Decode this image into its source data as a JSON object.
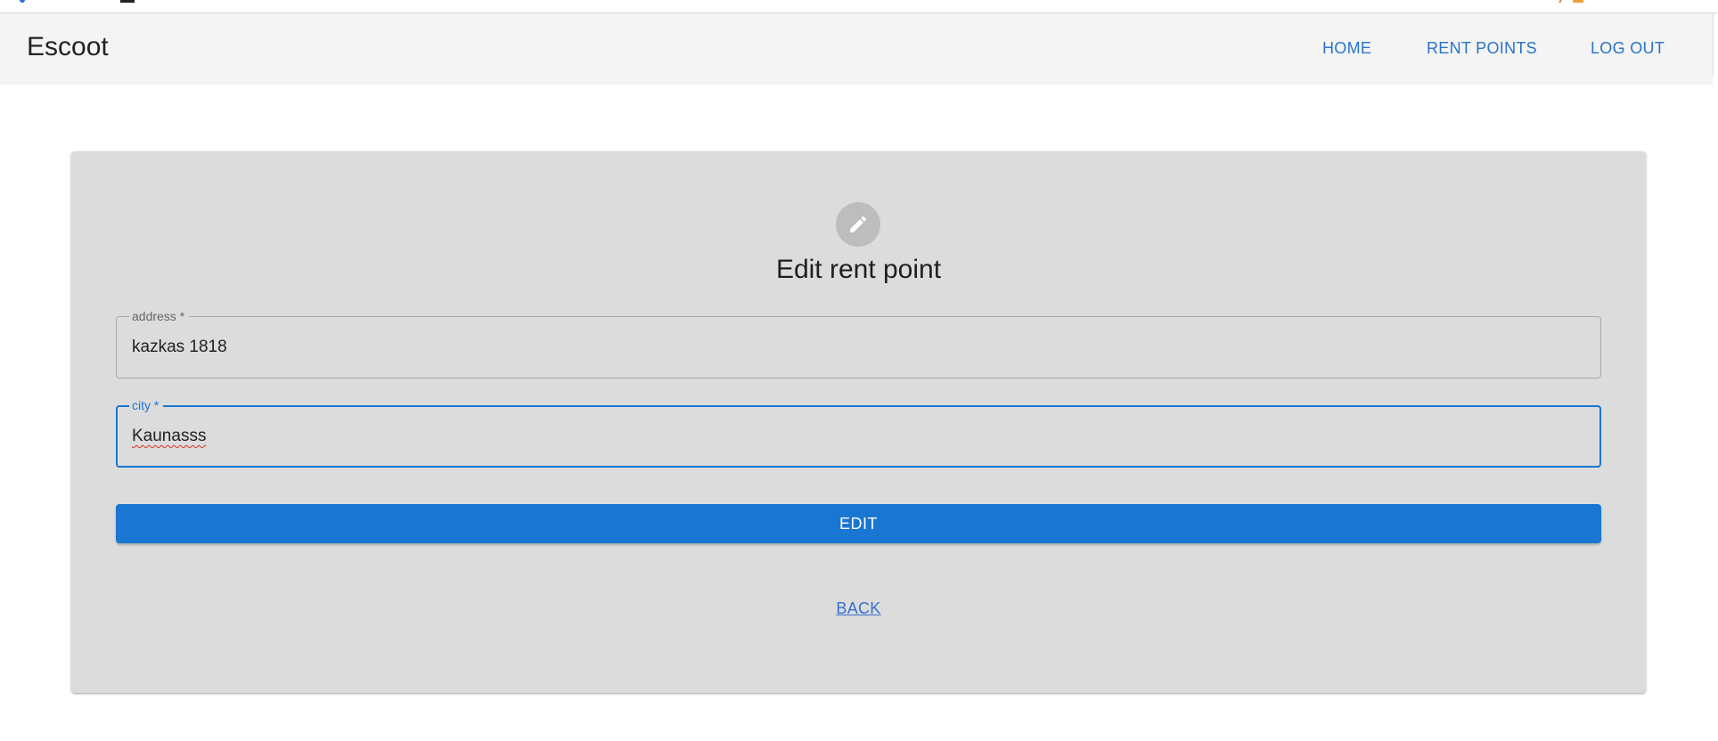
{
  "header": {
    "brand": "Escoot",
    "nav": [
      {
        "label": "HOME"
      },
      {
        "label": "RENT POINTS"
      },
      {
        "label": "LOG OUT"
      }
    ],
    "link_color": "#2a73c9"
  },
  "form": {
    "icon": "pencil-icon",
    "title": "Edit rent point",
    "address": {
      "label": "address *",
      "value": "kazkas 1818"
    },
    "city": {
      "label": "city *",
      "value": "Kaunasss"
    },
    "submit_label": "EDIT",
    "back_label": "BACK",
    "accent_color": "#1976d2",
    "card_color": "#dcdcdc"
  }
}
